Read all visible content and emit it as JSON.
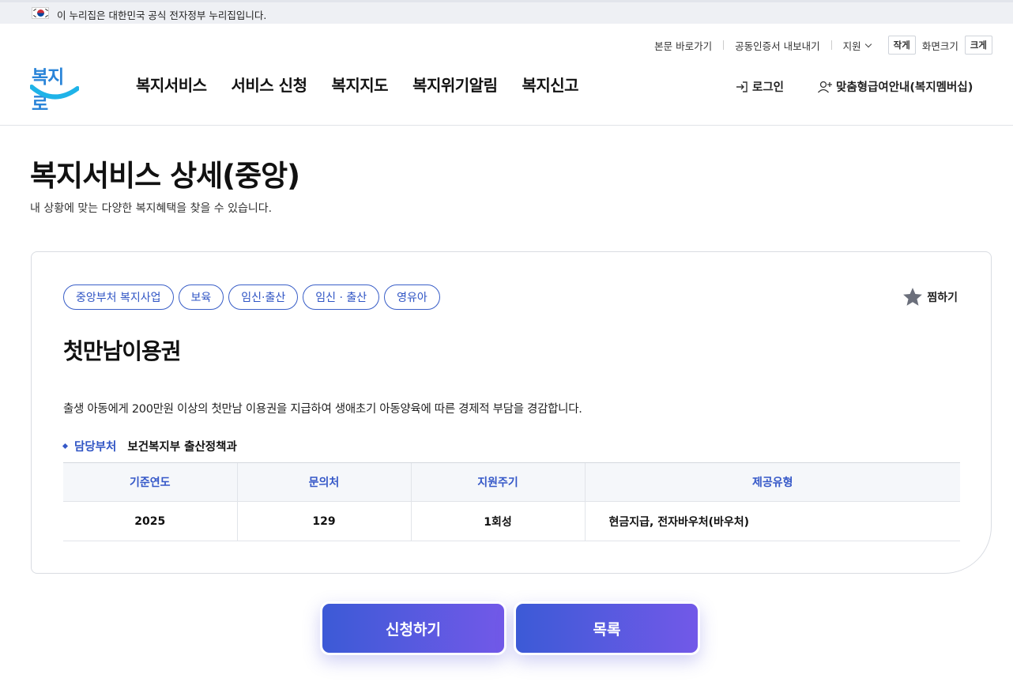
{
  "gov_banner": {
    "text": "이 누리집은 대한민국 공식 전자정부 누리집입니다."
  },
  "util": {
    "skip_link": "본문 바로가기",
    "cert_export": "공동인증서 내보내기",
    "support": "지원",
    "font_small": "작게",
    "font_label": "화면크기",
    "font_large": "크게"
  },
  "logo": {
    "text": "복지로"
  },
  "gnb": [
    "복지서비스",
    "서비스 신청",
    "복지지도",
    "복지위기알림",
    "복지신고"
  ],
  "header": {
    "login": "로그인",
    "membership": "맞춤형급여안내(복지멤버십)"
  },
  "page": {
    "title": "복지서비스 상세(중앙)",
    "desc": "내 상황에 맞는 다양한 복지혜택을 찾을 수 있습니다."
  },
  "card": {
    "tags": [
      "중앙부처 복지사업",
      "보육",
      "임신·출산",
      "임신 · 출산",
      "영유아"
    ],
    "bookmark": "찜하기",
    "title": "첫만남이용권",
    "desc": "출생 아동에게 200만원 이상의 첫만남 이용권을 지급하여 생애초기 아동양육에 따른 경제적 부담을 경감합니다.",
    "dept_label": "담당부처",
    "dept_value": "보건복지부 출산정책과",
    "table": {
      "headers": [
        "기준연도",
        "문의처",
        "지원주기",
        "제공유형"
      ],
      "row": [
        "2025",
        "129",
        "1회성",
        "현금지급, 전자바우처(바우처)"
      ]
    }
  },
  "buttons": {
    "apply": "신청하기",
    "list": "목록"
  },
  "colors": {
    "accent": "#2f54c4",
    "button_start": "#3c5ad6",
    "button_end": "#7259e8"
  }
}
